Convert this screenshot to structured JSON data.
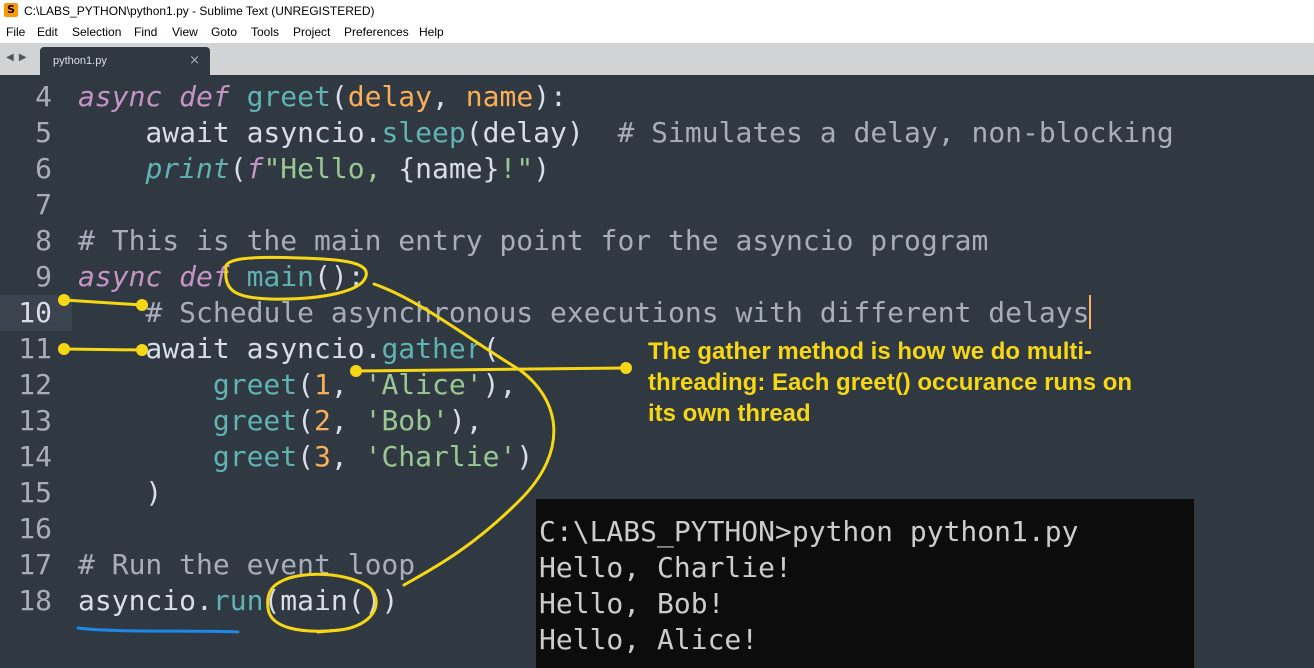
{
  "window": {
    "title": "C:\\LABS_PYTHON\\python1.py - Sublime Text (UNREGISTERED)",
    "app_icon": "S"
  },
  "menu": {
    "items": [
      "File",
      "Edit",
      "Selection",
      "Find",
      "View",
      "Goto",
      "Tools",
      "Project",
      "Preferences",
      "Help"
    ]
  },
  "tabs": {
    "nav": "◀ ▶",
    "active": {
      "label": "python1.py",
      "close": "×"
    }
  },
  "editor": {
    "current_line": 10,
    "lines": [
      {
        "n": "4",
        "tokens": [
          {
            "t": "async def ",
            "c": "kw"
          },
          {
            "t": "greet",
            "c": "fn"
          },
          {
            "t": "(",
            "c": ""
          },
          {
            "t": "delay",
            "c": "param"
          },
          {
            "t": ", ",
            "c": ""
          },
          {
            "t": "name",
            "c": "param"
          },
          {
            "t": "):",
            "c": ""
          }
        ]
      },
      {
        "n": "5",
        "tokens": [
          {
            "t": "    await asyncio.",
            "c": ""
          },
          {
            "t": "sleep",
            "c": "fn"
          },
          {
            "t": "(delay)  ",
            "c": ""
          },
          {
            "t": "# Simulates a delay, non-blocking",
            "c": "cm"
          }
        ]
      },
      {
        "n": "6",
        "tokens": [
          {
            "t": "    ",
            "c": ""
          },
          {
            "t": "print",
            "c": "kw fn"
          },
          {
            "t": "(",
            "c": ""
          },
          {
            "t": "f",
            "c": "kw"
          },
          {
            "t": "\"Hello, ",
            "c": "str"
          },
          {
            "t": "{name}",
            "c": ""
          },
          {
            "t": "!\"",
            "c": "str"
          },
          {
            "t": ")",
            "c": ""
          }
        ]
      },
      {
        "n": "7",
        "tokens": []
      },
      {
        "n": "8",
        "tokens": [
          {
            "t": "# This is the main entry point for the asyncio program",
            "c": "cm"
          }
        ]
      },
      {
        "n": "9",
        "tokens": [
          {
            "t": "async def ",
            "c": "kw"
          },
          {
            "t": "main",
            "c": "fn"
          },
          {
            "t": "():",
            "c": ""
          }
        ]
      },
      {
        "n": "10",
        "tokens": [
          {
            "t": "    ",
            "c": ""
          },
          {
            "t": "# Schedule asynchronous executions with different delays",
            "c": "cm"
          }
        ],
        "cursor": true
      },
      {
        "n": "11",
        "tokens": [
          {
            "t": "    await asyncio.",
            "c": ""
          },
          {
            "t": "gather",
            "c": "fn"
          },
          {
            "t": "(",
            "c": ""
          }
        ]
      },
      {
        "n": "12",
        "tokens": [
          {
            "t": "        ",
            "c": ""
          },
          {
            "t": "greet",
            "c": "fn"
          },
          {
            "t": "(",
            "c": ""
          },
          {
            "t": "1",
            "c": "num"
          },
          {
            "t": ", ",
            "c": ""
          },
          {
            "t": "'Alice'",
            "c": "str"
          },
          {
            "t": "),",
            "c": ""
          }
        ]
      },
      {
        "n": "13",
        "tokens": [
          {
            "t": "        ",
            "c": ""
          },
          {
            "t": "greet",
            "c": "fn"
          },
          {
            "t": "(",
            "c": ""
          },
          {
            "t": "2",
            "c": "num"
          },
          {
            "t": ", ",
            "c": ""
          },
          {
            "t": "'Bob'",
            "c": "str"
          },
          {
            "t": "),",
            "c": ""
          }
        ]
      },
      {
        "n": "14",
        "tokens": [
          {
            "t": "        ",
            "c": ""
          },
          {
            "t": "greet",
            "c": "fn"
          },
          {
            "t": "(",
            "c": ""
          },
          {
            "t": "3",
            "c": "num"
          },
          {
            "t": ", ",
            "c": ""
          },
          {
            "t": "'Charlie'",
            "c": "str"
          },
          {
            "t": ")",
            "c": ""
          }
        ]
      },
      {
        "n": "15",
        "tokens": [
          {
            "t": "    )",
            "c": ""
          }
        ]
      },
      {
        "n": "16",
        "tokens": []
      },
      {
        "n": "17",
        "tokens": [
          {
            "t": "# Run the event loop",
            "c": "cm"
          }
        ]
      },
      {
        "n": "18",
        "tokens": [
          {
            "t": "asyncio.",
            "c": ""
          },
          {
            "t": "run",
            "c": "fn"
          },
          {
            "t": "(main())",
            "c": ""
          }
        ]
      }
    ]
  },
  "annotation": {
    "text": "The gather method is how we do multi-threading: Each greet() occurance runs on its own thread",
    "lines": [
      "The gather method is how we do multi-",
      "threading: Each greet() occurance runs on",
      "its own thread"
    ],
    "color": "#f5d716"
  },
  "terminal": {
    "lines": [
      "C:\\LABS_PYTHON>python python1.py",
      "Hello, Charlie!",
      "Hello, Bob!",
      "Hello, Alice!"
    ]
  },
  "colors": {
    "editor_bg": "#303841",
    "keyword": "#c594c5",
    "function": "#5fb3b3",
    "number": "#f9ae58",
    "string": "#99c794",
    "comment": "#a7adba",
    "ink_yellow": "#f5d716",
    "ink_blue": "#1e88e5"
  }
}
